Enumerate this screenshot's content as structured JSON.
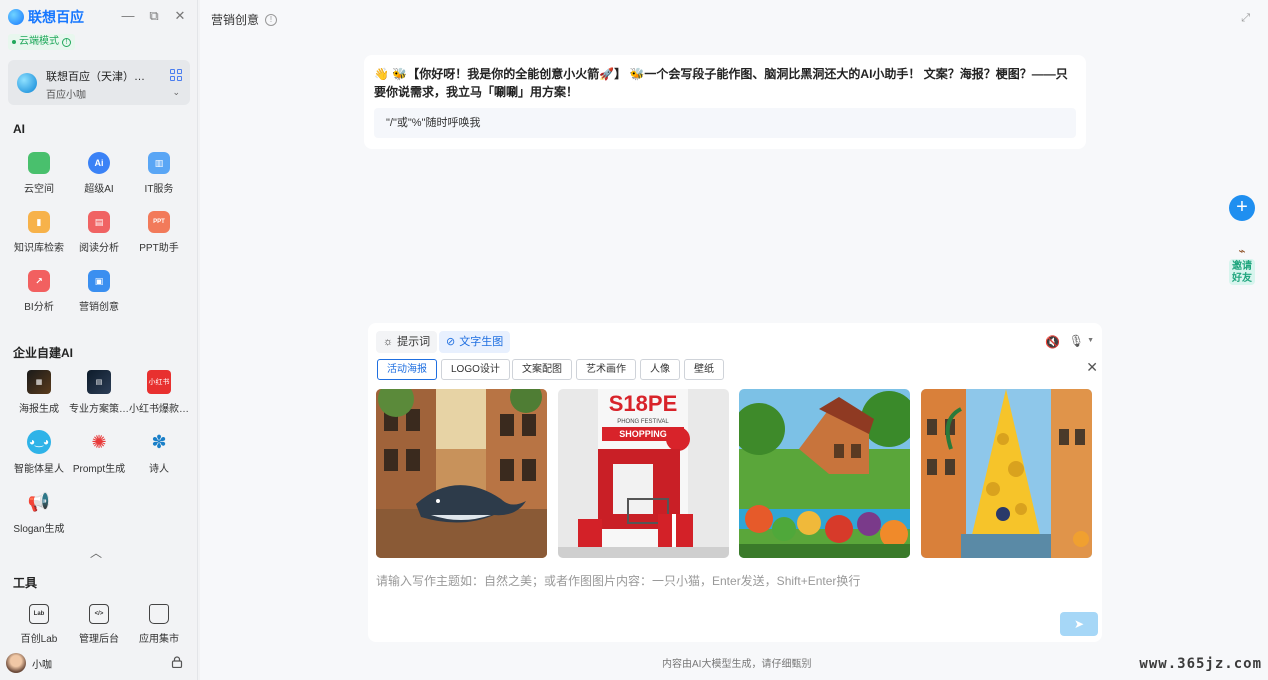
{
  "app": {
    "brand": "联想百应",
    "cloud_mode": "云端模式",
    "window_controls": [
      "—",
      "⧉",
      "✕"
    ]
  },
  "org": {
    "name": "联想百应（天津）…",
    "assistant": "百应小咖"
  },
  "sections": {
    "ai": "AI",
    "enterprise": "企业自建AI",
    "tools": "工具"
  },
  "ai_apps": [
    {
      "label": "云空间",
      "icon": "cloud-folder-icon",
      "color": "#49c06d"
    },
    {
      "label": "超级AI",
      "icon": "super-ai-icon",
      "color": "#3b82f6"
    },
    {
      "label": "IT服务",
      "icon": "it-service-icon",
      "color": "#5aa6f5"
    },
    {
      "label": "知识库检索",
      "icon": "knowledge-base-icon",
      "color": "#f7b24a"
    },
    {
      "label": "阅读分析",
      "icon": "reading-analysis-icon",
      "color": "#f06363"
    },
    {
      "label": "PPT助手",
      "icon": "ppt-icon",
      "color": "#f27a5a"
    },
    {
      "label": "BI分析",
      "icon": "bi-chart-icon",
      "color": "#f26060"
    },
    {
      "label": "营销创意",
      "icon": "marketing-icon",
      "color": "#3a8ff0"
    }
  ],
  "enterprise_apps": [
    {
      "label": "海报生成",
      "icon": "poster-thumbnail-icon"
    },
    {
      "label": "专业方案策…",
      "icon": "plan-thumbnail-icon"
    },
    {
      "label": "小红书爆款…",
      "icon": "xiaohongshu-icon",
      "badge": "小红书"
    },
    {
      "label": "智能体星人",
      "icon": "alien-face-icon"
    },
    {
      "label": "Prompt生成",
      "icon": "lightbulb-icon"
    },
    {
      "label": "诗人",
      "icon": "dancing-figure-icon"
    },
    {
      "label": "Slogan生成",
      "icon": "megaphone-icon"
    }
  ],
  "tools": [
    {
      "label": "百创Lab",
      "icon": "lab-icon",
      "glyph": "Lab"
    },
    {
      "label": "管理后台",
      "icon": "code-window-icon",
      "glyph": "</>"
    },
    {
      "label": "应用集市",
      "icon": "shopping-bag-icon",
      "glyph": ""
    }
  ],
  "user": {
    "name": "小咖"
  },
  "page": {
    "title": "营销创意"
  },
  "welcome": {
    "message": "👋 🐝【你好呀！我是你的全能创意小火箭🚀】 🐝一个会写段子能作图、脑洞比黑洞还大的AI小助手！ 文案？海报？梗图？——只要你说需求，我立马「唰唰」用方案！",
    "hint": "\"/\"或\"%\"随时呼唤我"
  },
  "invite": {
    "label_line1": "邀请",
    "label_line2": "好友"
  },
  "composer": {
    "modes": [
      {
        "label": "提示词",
        "icon": "bulb-small-icon"
      },
      {
        "label": "文字生图",
        "icon": "image-gen-icon"
      }
    ],
    "categories": [
      "活动海报",
      "LOGO设计",
      "文案配图",
      "艺术画作",
      "人像",
      "壁纸"
    ],
    "active_category": "活动海报",
    "thumbnails": [
      {
        "name": "whale-street-image"
      },
      {
        "name": "shopping-festival-image",
        "text_top": "S18PE",
        "text_sub": "PHONG FESTIVAL",
        "text_tag": "SHOPPING"
      },
      {
        "name": "fruit-village-image"
      },
      {
        "name": "cheese-city-image"
      }
    ],
    "placeholder": "请输入写作主题如：自然之美；或者作图图片内容：一只小猫，Enter发送，Shift+Enter换行"
  },
  "footer": {
    "disclaimer": "内容由AI大模型生成，请仔细甄别"
  },
  "watermark": "www.365jz.com"
}
